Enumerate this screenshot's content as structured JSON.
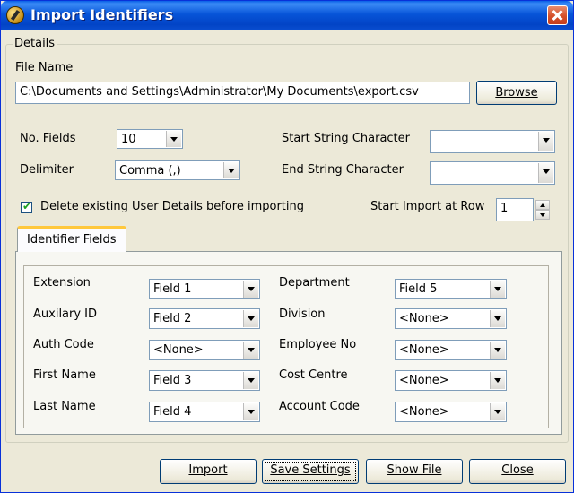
{
  "window": {
    "title": "Import Identifiers"
  },
  "details": {
    "legend": "Details",
    "file_name_label": "File Name",
    "file_name_value": "C:\\Documents and Settings\\Administrator\\My Documents\\export.csv",
    "browse_label": "Browse",
    "no_fields_label": "No. Fields",
    "no_fields_value": "10",
    "delimiter_label": "Delimiter",
    "delimiter_value": "Comma (,)",
    "start_string_label": "Start String Character",
    "start_string_value": "",
    "end_string_label": "End String Character",
    "end_string_value": "",
    "delete_checkbox_label": "Delete existing User Details before importing",
    "delete_checked": true,
    "start_row_label": "Start Import at Row",
    "start_row_value": "1"
  },
  "tabs": [
    {
      "label": "Identifier Fields",
      "active": true
    }
  ],
  "identifier_fields": {
    "left": [
      {
        "label": "Extension",
        "value": "Field 1"
      },
      {
        "label": "Auxilary ID",
        "value": "Field 2"
      },
      {
        "label": "Auth Code",
        "value": "<None>"
      },
      {
        "label": "First Name",
        "value": "Field 3"
      },
      {
        "label": "Last Name",
        "value": "Field 4"
      }
    ],
    "right": [
      {
        "label": "Department",
        "value": "Field 5"
      },
      {
        "label": "Division",
        "value": "<None>"
      },
      {
        "label": "Employee No",
        "value": "<None>"
      },
      {
        "label": "Cost Centre",
        "value": "<None>"
      },
      {
        "label": "Account Code",
        "value": "<None>"
      }
    ]
  },
  "buttons": {
    "import": "Import",
    "save_settings": "Save Settings",
    "show_file": "Show File",
    "close": "Close"
  },
  "colors": {
    "titlebar": "#0754d8",
    "dialog_bg": "#ece9d8",
    "tab_highlight": "#ffc83c",
    "close_button": "#d4502a"
  }
}
